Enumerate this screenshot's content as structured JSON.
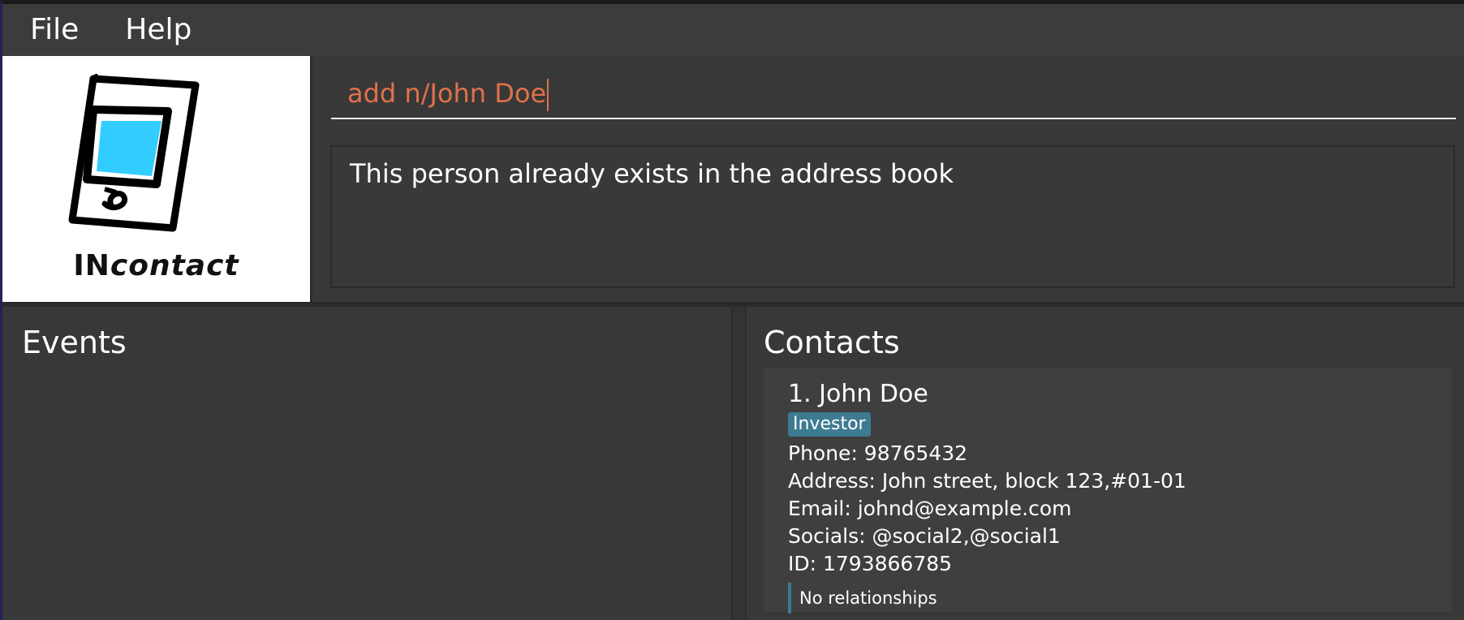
{
  "menu": {
    "file": "File",
    "help": "Help"
  },
  "logo": {
    "prefix": "IN",
    "suffix": "contact"
  },
  "command": {
    "value": "add n/John Doe"
  },
  "result": {
    "message": "This person already exists in the address book"
  },
  "events": {
    "title": "Events"
  },
  "contacts": {
    "title": "Contacts",
    "items": [
      {
        "name": "1. John Doe",
        "tag": "Investor",
        "phone": "Phone: 98765432",
        "address": "Address: John street, block 123,#01-01",
        "email": "Email: johnd@example.com",
        "socials": "Socials: @social2,@social1",
        "id": "ID: 1793866785",
        "relationships": "No relationships"
      }
    ]
  },
  "colors": {
    "background": "#383838",
    "command_text": "#e0714a",
    "tag": "#3e7b91",
    "logo_screen": "#33ccff"
  }
}
